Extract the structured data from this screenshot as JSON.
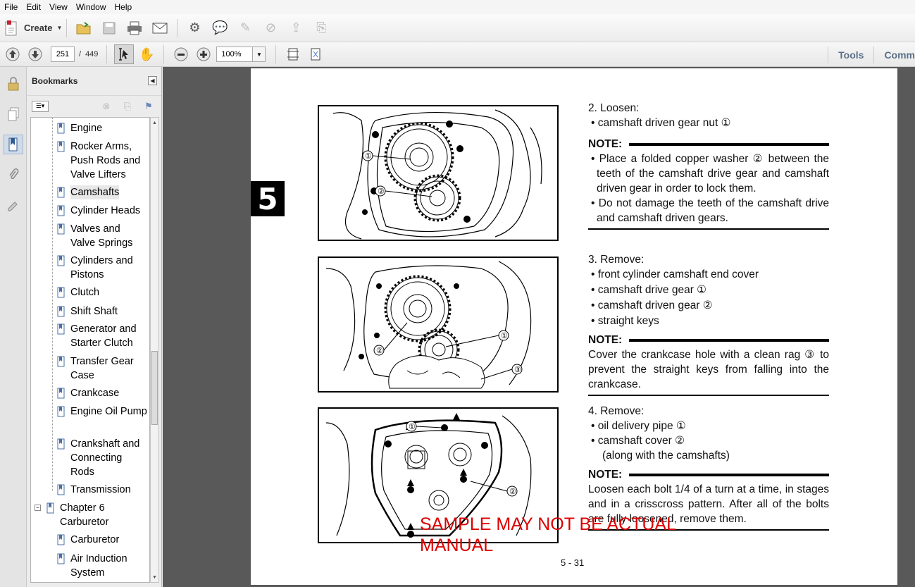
{
  "menu": [
    "File",
    "Edit",
    "View",
    "Window",
    "Help"
  ],
  "toolbar": {
    "create_label": "Create",
    "page_current": "251",
    "page_total": "449",
    "zoom": "100%",
    "tools_label": "Tools",
    "comment_label": "Comm"
  },
  "bookmarks": {
    "title": "Bookmarks",
    "items": [
      {
        "label": "Engine",
        "level": 1
      },
      {
        "label": "Rocker Arms, Push Rods and Valve Lifters",
        "level": 1
      },
      {
        "label": "Camshafts",
        "level": 1,
        "selected": true
      },
      {
        "label": "Cylinder Heads",
        "level": 1
      },
      {
        "label": "Valves and Valve Springs",
        "level": 1
      },
      {
        "label": "Cylinders and Pistons",
        "level": 1
      },
      {
        "label": "Clutch",
        "level": 1
      },
      {
        "label": "Shift Shaft",
        "level": 1
      },
      {
        "label": "Generator and Starter Clutch",
        "level": 1
      },
      {
        "label": "Transfer Gear Case",
        "level": 1
      },
      {
        "label": "Crankcase",
        "level": 1
      },
      {
        "label": "Engine Oil Pump",
        "level": 1
      },
      {
        "label": "Crankshaft and Connecting Rods",
        "level": 1
      },
      {
        "label": "Transmission",
        "level": 1
      },
      {
        "label": "Chapter 6 Carburetor",
        "level": 0,
        "expander": "−"
      },
      {
        "label": "Carburetor",
        "level": 1
      },
      {
        "label": "Air Induction System",
        "level": 1
      }
    ]
  },
  "doc": {
    "chapter_tab": "5",
    "step2": {
      "title": "2. Loosen:",
      "bullets": [
        "camshaft driven gear nut ①"
      ],
      "note_label": "NOTE:",
      "note_bullets": [
        "Place a folded copper washer ② between the teeth of the camshaft drive gear and camshaft driven gear in order to lock them.",
        "Do not damage the teeth of the camshaft drive and camshaft driven gears."
      ]
    },
    "step3": {
      "title": "3. Remove:",
      "bullets": [
        "front cylinder camshaft end cover",
        "camshaft drive gear ①",
        "camshaft driven gear ②",
        "straight keys"
      ],
      "note_label": "NOTE:",
      "note_text": "Cover the crankcase hole with a clean rag ③ to prevent the straight keys from falling into the crankcase."
    },
    "step4": {
      "title": "4. Remove:",
      "bullets": [
        "oil delivery pipe ①",
        "camshaft cover ②"
      ],
      "sub": "(along with the camshafts)",
      "note_label": "NOTE:",
      "note_text": "Loosen each bolt 1/4 of a turn at a time, in stages and in a crisscross pattern. After all of the bolts are fully loosened, remove them."
    },
    "page_number": "5 - 31",
    "watermark": "SAMPLE MAY NOT BE ACTUAL MANUAL",
    "fig_labels": {
      "fig1": [
        "①",
        "②"
      ],
      "fig2": [
        "①",
        "②",
        "③"
      ],
      "fig3": [
        "①",
        "②"
      ]
    }
  }
}
